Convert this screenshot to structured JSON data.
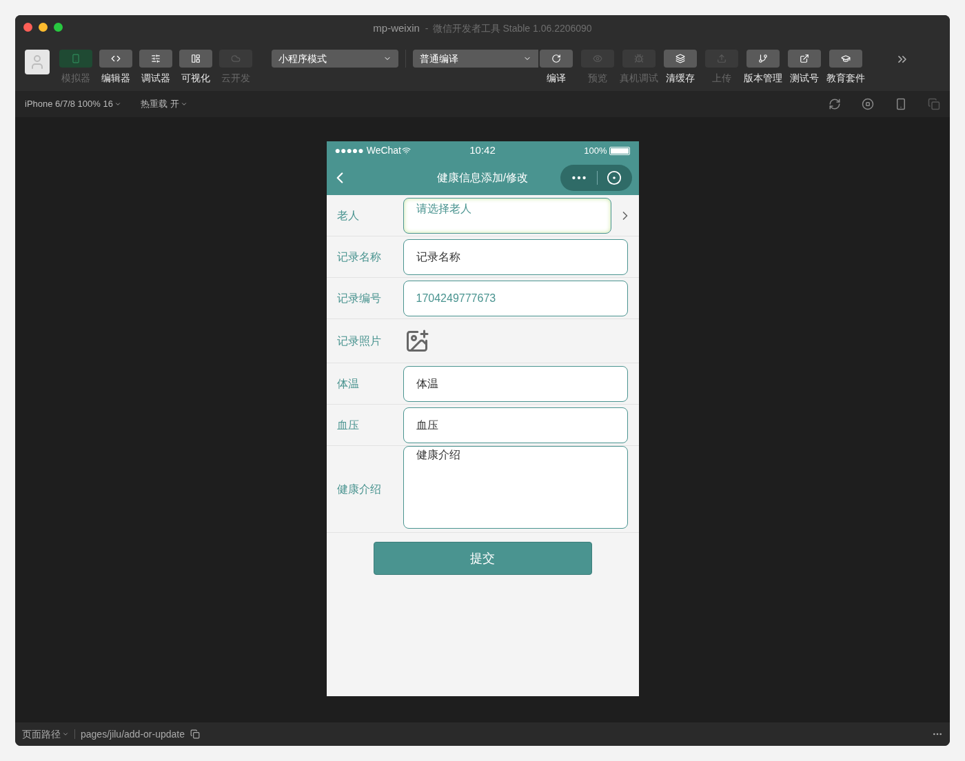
{
  "window": {
    "title": "mp-weixin",
    "separator": "-",
    "subtitle": "微信开发者工具 Stable 1.06.2206090"
  },
  "toolbar": {
    "left_buttons": [
      {
        "label": "模拟器",
        "selected": true,
        "disabled": true
      },
      {
        "label": "编辑器",
        "selected": false,
        "disabled": false
      },
      {
        "label": "调试器",
        "selected": false,
        "disabled": false
      },
      {
        "label": "可视化",
        "selected": false,
        "disabled": false
      },
      {
        "label": "云开发",
        "selected": false,
        "disabled": true
      }
    ],
    "mode_select": "小程序模式",
    "compile_select": "普通编译",
    "right_buttons": [
      {
        "label": "编译",
        "disabled": false
      },
      {
        "label": "预览",
        "disabled": true
      },
      {
        "label": "真机调试",
        "disabled": true
      },
      {
        "label": "清缓存",
        "disabled": false
      },
      {
        "label": "上传",
        "disabled": true
      },
      {
        "label": "版本管理",
        "disabled": false
      },
      {
        "label": "测试号",
        "disabled": false
      },
      {
        "label": "教育套件",
        "disabled": false
      }
    ]
  },
  "subbar": {
    "device": "iPhone 6/7/8 100% 16",
    "hot_reload": "热重载 开"
  },
  "phone": {
    "status": {
      "carrier": "●●●●● WeChat",
      "time": "10:42",
      "battery": "100%"
    },
    "nav_title": "健康信息添加/修改",
    "form": [
      {
        "kind": "picker",
        "label": "老人",
        "placeholder": "请选择老人"
      },
      {
        "kind": "input",
        "label": "记录名称",
        "placeholder": "记录名称"
      },
      {
        "kind": "input",
        "label": "记录编号",
        "value": "1704249777673"
      },
      {
        "kind": "image",
        "label": "记录照片"
      },
      {
        "kind": "input",
        "label": "体温",
        "placeholder": "体温"
      },
      {
        "kind": "input",
        "label": "血压",
        "placeholder": "血压"
      },
      {
        "kind": "textarea",
        "label": "健康介绍",
        "placeholder": "健康介绍"
      }
    ],
    "submit": "提交"
  },
  "status_bar": {
    "path_label": "页面路径",
    "path": "pages/jilu/add-or-update"
  }
}
